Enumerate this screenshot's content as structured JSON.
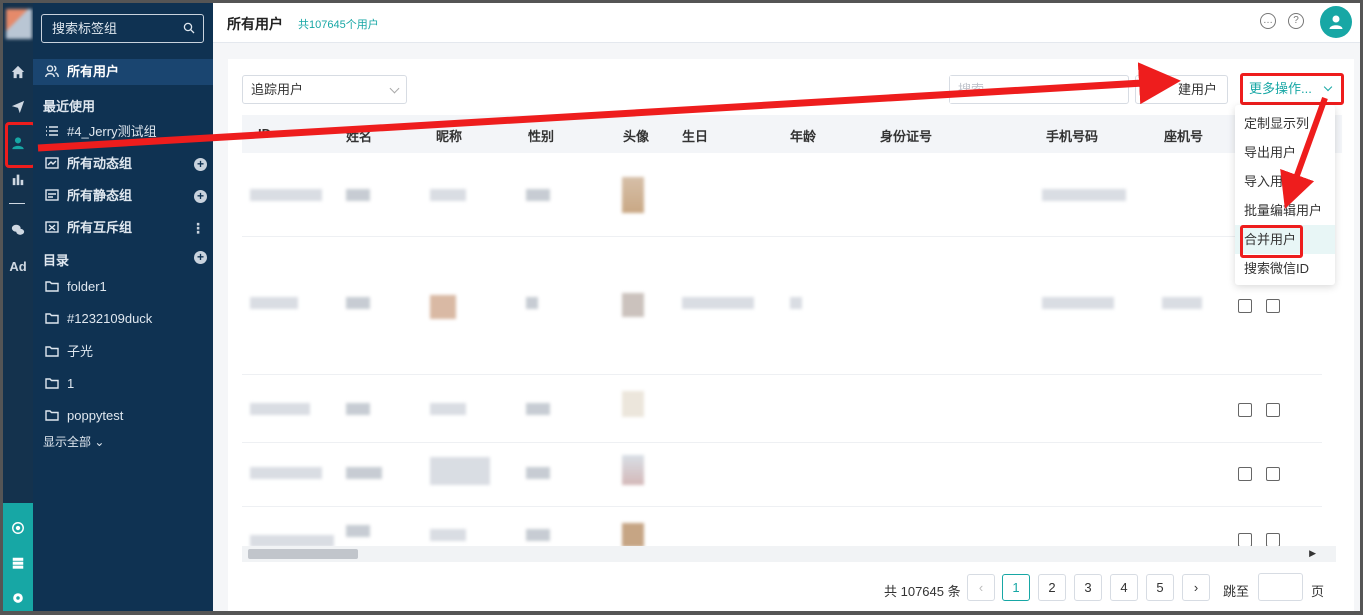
{
  "sidebar": {
    "tag_search_placeholder": "搜索标签组",
    "active_item": "所有用户",
    "recent_heading": "最近使用",
    "recent_items": [
      "#4_Jerry测试组"
    ],
    "groups": [
      "所有动态组",
      "所有静态组",
      "所有互斥组"
    ],
    "directory_heading": "目录",
    "folders": [
      "folder1",
      "#1232109duck",
      "子光",
      "1",
      "poppytest"
    ],
    "show_all": "显示全部"
  },
  "rail": {
    "ad_label": "Ad"
  },
  "header": {
    "title": "所有用户",
    "count_text": "共107645个用户"
  },
  "toolbar": {
    "filter_value": "追踪用户",
    "search_placeholder": "搜索",
    "create_label": "建用户",
    "more_label": "更多操作..."
  },
  "table": {
    "columns": [
      "ID",
      "姓名",
      "昵称",
      "性别",
      "头像",
      "生日",
      "年龄",
      "身份证号",
      "手机号码",
      "座机号"
    ]
  },
  "more_menu": {
    "items": [
      "定制显示列",
      "导出用户",
      "导入用户",
      "批量编辑用户",
      "合并用户",
      "搜索微信ID"
    ]
  },
  "pagination": {
    "total_text": "共 107645 条",
    "pages": [
      "1",
      "2",
      "3",
      "4",
      "5"
    ],
    "current": "1",
    "jump_label": "跳至",
    "page_unit": "页"
  },
  "colors": {
    "accent": "#17a7a5",
    "sidebar_bg": "#0f3252",
    "annotation": "#ee1d1d"
  }
}
